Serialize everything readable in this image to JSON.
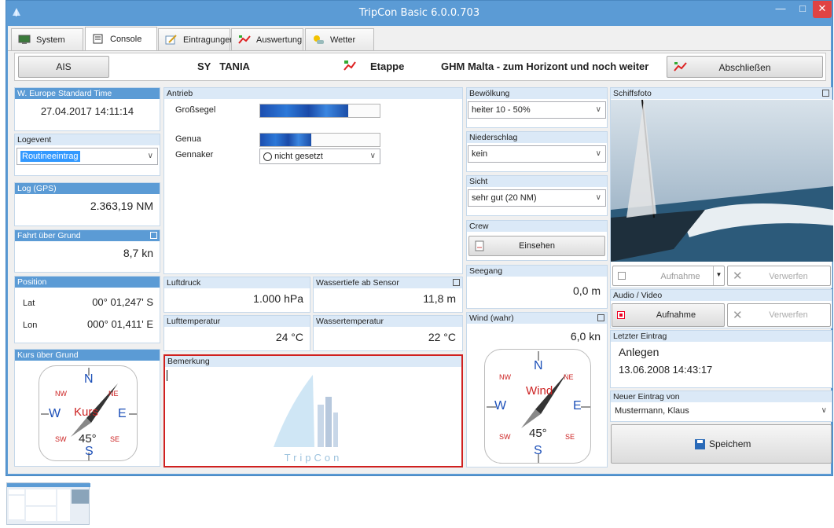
{
  "window": {
    "title": "TripCon Basic 6.0.0.703"
  },
  "tabs": [
    {
      "label": "System"
    },
    {
      "label": "Console"
    },
    {
      "label": "Eintragungen"
    },
    {
      "label": "Auswertung"
    },
    {
      "label": "Wetter"
    }
  ],
  "header": {
    "ais_label": "AIS",
    "vessel_prefix": "SY",
    "vessel_name": "TANIA",
    "etappe_label": "Etappe",
    "etappe_name": "GHM Malta - zum Horizont und noch weiter",
    "close_button": "Abschließen"
  },
  "time_panel": {
    "title": "W. Europe Standard Time",
    "value": "27.04.2017 14:11:14"
  },
  "logevent": {
    "title": "Logevent",
    "selected": "Routineeintrag"
  },
  "log_gps": {
    "title": "Log (GPS)",
    "value": "2.363,19 NM"
  },
  "fahrt": {
    "title": "Fahrt über Grund",
    "value": "8,7 kn"
  },
  "position": {
    "title": "Position",
    "lat_label": "Lat",
    "lat": "00° 01,247' S",
    "lon_label": "Lon",
    "lon": "000° 01,411' E"
  },
  "kurs": {
    "title": "Kurs über Grund",
    "center_label": "Kurs",
    "degrees": "45°",
    "n": "N",
    "s": "S",
    "e": "E",
    "w": "W",
    "nw": "NW",
    "ne": "NE",
    "sw": "SW",
    "se": "SE"
  },
  "antrieb": {
    "title": "Antrieb",
    "grosssegel_label": "Großsegel",
    "grosssegel_fill": 0.74,
    "genua_label": "Genua",
    "genua_fill": 0.43,
    "gennaker_label": "Gennaker",
    "gennaker_value": "nicht gesetzt"
  },
  "luftdruck": {
    "title": "Luftdruck",
    "value": "1.000 hPa"
  },
  "wassertiefe": {
    "title": "Wassertiefe ab Sensor",
    "value": "11,8 m"
  },
  "lufttemp": {
    "title": "Lufttemperatur",
    "value": "24 °C"
  },
  "wassertemp": {
    "title": "Wassertemperatur",
    "value": "22 °C"
  },
  "bemerkung": {
    "title": "Bemerkung",
    "watermark": "TripCon"
  },
  "bewoelkung": {
    "title": "Bewölkung",
    "selected": "heiter 10 - 50%"
  },
  "niederschlag": {
    "title": "Niederschlag",
    "selected": "kein"
  },
  "sicht": {
    "title": "Sicht",
    "selected": "sehr gut (20 NM)"
  },
  "crew": {
    "title": "Crew",
    "button": "Einsehen"
  },
  "seegang": {
    "title": "Seegang",
    "value": "0,0 m"
  },
  "wind": {
    "title": "Wind (wahr)",
    "value": "6,0 kn",
    "center_label": "Wind",
    "degrees": "45°",
    "n": "N",
    "s": "S",
    "e": "E",
    "w": "W",
    "nw": "NW",
    "ne": "NE",
    "sw": "SW",
    "se": "SE"
  },
  "schiffsfoto": {
    "title": "Schiffsfoto",
    "record": "Aufnahme",
    "discard": "Verwerfen"
  },
  "audio_video": {
    "title": "Audio / Video",
    "record": "Aufnahme",
    "discard": "Verwerfen"
  },
  "letzter_eintrag": {
    "title": "Letzter Eintrag",
    "type": "Anlegen",
    "datetime": "13.06.2008 14:43:17"
  },
  "neuer_eintrag": {
    "title": "Neuer Eintrag von",
    "selected": "Mustermann, Klaus"
  },
  "save": {
    "label": "Speichem"
  },
  "colors": {
    "accent": "#5b9bd5",
    "compass_letters": "#1c4fb8",
    "compass_accent": "#cc2222",
    "bemerkung_border": "#d0201f"
  }
}
